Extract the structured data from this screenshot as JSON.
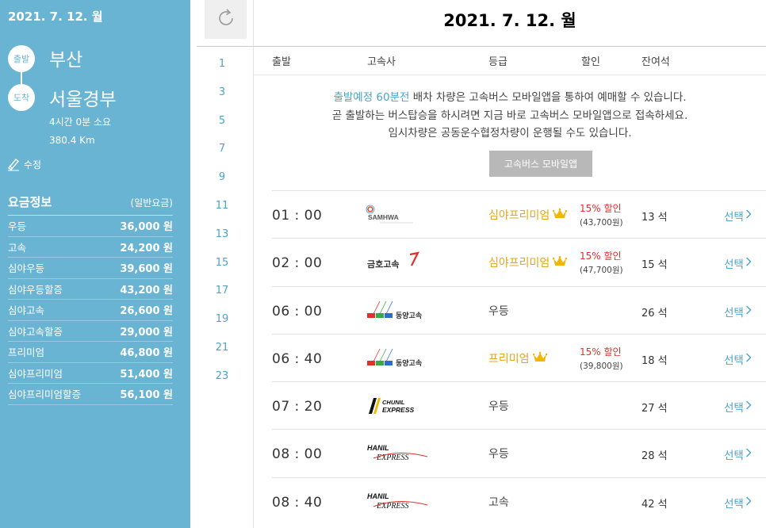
{
  "sidebar": {
    "date": "2021. 7. 12. 월",
    "departure_badge": "출발",
    "departure": "부산",
    "arrival_badge": "도착",
    "arrival": "서울경부",
    "duration": "4시간 0분 소요",
    "distance": "380.4 Km",
    "edit_label": "수정",
    "fare_title": "요금정보",
    "fare_subtitle": "(일반요금)",
    "fares": [
      {
        "name": "우등",
        "price": "36,000 원"
      },
      {
        "name": "고속",
        "price": "24,200 원"
      },
      {
        "name": "심야우등",
        "price": "39,600 원"
      },
      {
        "name": "심야우등할증",
        "price": "43,200 원"
      },
      {
        "name": "심야고속",
        "price": "26,600 원"
      },
      {
        "name": "심야고속할증",
        "price": "29,000 원"
      },
      {
        "name": "프리미엄",
        "price": "46,800 원"
      },
      {
        "name": "심야프리미엄",
        "price": "51,400 원"
      },
      {
        "name": "심야프리미엄할증",
        "price": "56,100 원"
      }
    ]
  },
  "hours": [
    "1",
    "3",
    "5",
    "7",
    "9",
    "11",
    "13",
    "15",
    "17",
    "19",
    "21",
    "23"
  ],
  "main": {
    "title": "2021. 7. 12. 월",
    "headers": {
      "depart": "출발",
      "company": "고속사",
      "grade": "등급",
      "discount": "할인",
      "seats": "잔여석"
    },
    "notice": {
      "line1_highlight": "출발예정 60분전",
      "line1_rest": " 배차 차량은 고속버스 모바일앱을 통하여 예매할 수 있습니다.",
      "line2": "곧 출발하는 버스탑승을 하시려면 지금 바로 고속버스 모바일앱으로 접속하세요.",
      "line3": "임시차량은 공동운수협정차량이 운행될 수도 있습니다."
    },
    "app_button": "고속버스 모바일앱",
    "select_label": "선택",
    "rows": [
      {
        "time": "01 : 00",
        "company": "samhwa",
        "logo_text": "SAMHWA",
        "grade": "심야프리미엄",
        "premium": true,
        "discount": "15% 할인",
        "discount_price": "(43,700원)",
        "seats": "13 석"
      },
      {
        "time": "02 : 00",
        "company": "kumho",
        "logo_text": "금호고속",
        "grade": "심야프리미엄",
        "premium": true,
        "discount": "15% 할인",
        "discount_price": "(47,700원)",
        "seats": "15 석"
      },
      {
        "time": "06 : 00",
        "company": "dongyang",
        "logo_text": "동양고속",
        "grade": "우등",
        "premium": false,
        "discount": "",
        "discount_price": "",
        "seats": "26 석"
      },
      {
        "time": "06 : 40",
        "company": "dongyang",
        "logo_text": "동양고속",
        "grade": "프리미엄",
        "premium": true,
        "discount": "15% 할인",
        "discount_price": "(39,800원)",
        "seats": "18 석"
      },
      {
        "time": "07 : 20",
        "company": "chunil",
        "logo_text": "CHUNIL EXPRESS",
        "grade": "우등",
        "premium": false,
        "discount": "",
        "discount_price": "",
        "seats": "27 석"
      },
      {
        "time": "08 : 00",
        "company": "hanil",
        "logo_text": "HANIL EXPRESS",
        "grade": "우등",
        "premium": false,
        "discount": "",
        "discount_price": "",
        "seats": "28 석"
      },
      {
        "time": "08 : 40",
        "company": "hanil",
        "logo_text": "HANIL EXPRESS",
        "grade": "고속",
        "premium": false,
        "discount": "",
        "discount_price": "",
        "seats": "42 석"
      }
    ]
  },
  "colors": {
    "sidebar_bg": "#6ab4d3",
    "accent": "#4aa3c8",
    "gold": "#e7a51a",
    "discount_red": "#e0302a"
  },
  "icons": {
    "refresh": "refresh-icon",
    "edit": "pencil-icon",
    "premium": "crown-icon",
    "select": "chevron-right-icon"
  }
}
